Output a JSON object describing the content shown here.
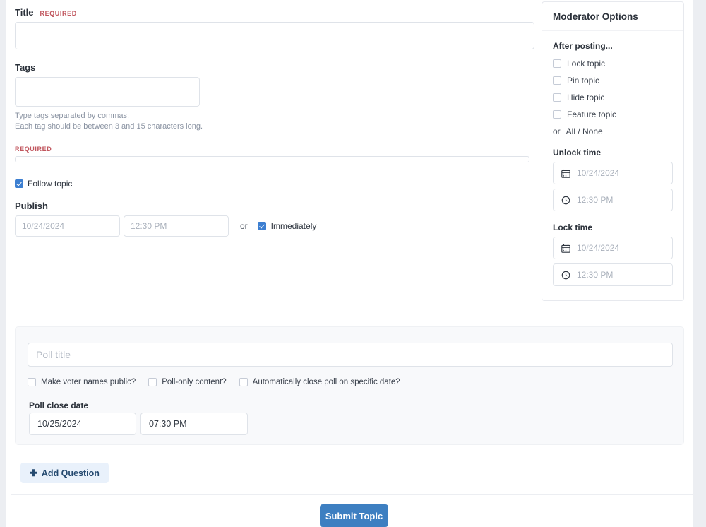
{
  "form": {
    "title": {
      "label": "Title",
      "required_badge": "REQUIRED",
      "value": "",
      "placeholder": ""
    },
    "tags": {
      "label": "Tags",
      "value": "",
      "placeholder": "",
      "help_line_1": "Type tags separated by commas.",
      "help_line_2": "Each tag should be between 3 and 15 characters long."
    },
    "body": {
      "required_badge": "REQUIRED",
      "value": "",
      "placeholder": ""
    },
    "follow_topic": {
      "label": "Follow topic",
      "checked": true
    },
    "publish": {
      "label": "Publish",
      "date_value": "10/24/2024",
      "date_month": "10",
      "date_day": "24",
      "date_year": "2024",
      "time_value": "12:30 PM",
      "or_text": "or",
      "immediately_label": "Immediately",
      "immediately_checked": true
    }
  },
  "moderator": {
    "title": "Moderator Options",
    "after_posting_label": "After posting...",
    "options": [
      {
        "label": "Lock topic",
        "checked": false
      },
      {
        "label": "Pin topic",
        "checked": false
      },
      {
        "label": "Hide topic",
        "checked": false
      },
      {
        "label": "Feature topic",
        "checked": false
      }
    ],
    "or_text": "or",
    "all_none_label": "All / None",
    "unlock_time": {
      "label": "Unlock time",
      "date_month": "10",
      "date_day": "24",
      "date_year": "2024",
      "time_value": "12:30 PM",
      "calendar_icon": "calendar-icon",
      "clock_icon": "clock-icon"
    },
    "lock_time": {
      "label": "Lock time",
      "date_month": "10",
      "date_day": "24",
      "date_year": "2024",
      "time_value": "12:30 PM",
      "calendar_icon": "calendar-icon",
      "clock_icon": "clock-icon"
    }
  },
  "poll": {
    "title_placeholder": "Poll title",
    "title_value": "",
    "checkboxes": [
      {
        "label": "Make voter names public?",
        "checked": false
      },
      {
        "label": "Poll-only content?",
        "checked": false
      },
      {
        "label": "Automatically close poll on specific date?",
        "checked": false
      }
    ],
    "close_date_label": "Poll close date",
    "close_date_value": "10/25/2024",
    "close_time_value": "07:30 PM",
    "add_question_label": "Add Question",
    "add_question_icon": "plus-icon"
  },
  "footer": {
    "submit_label": "Submit Topic"
  },
  "colors": {
    "accent_blue": "#3d7fc1",
    "checkbox_blue": "#3d7fd1",
    "required_red": "#c1565e",
    "add_question_bg": "#e9f1fb",
    "panel_bg": "#f8f9fb"
  }
}
